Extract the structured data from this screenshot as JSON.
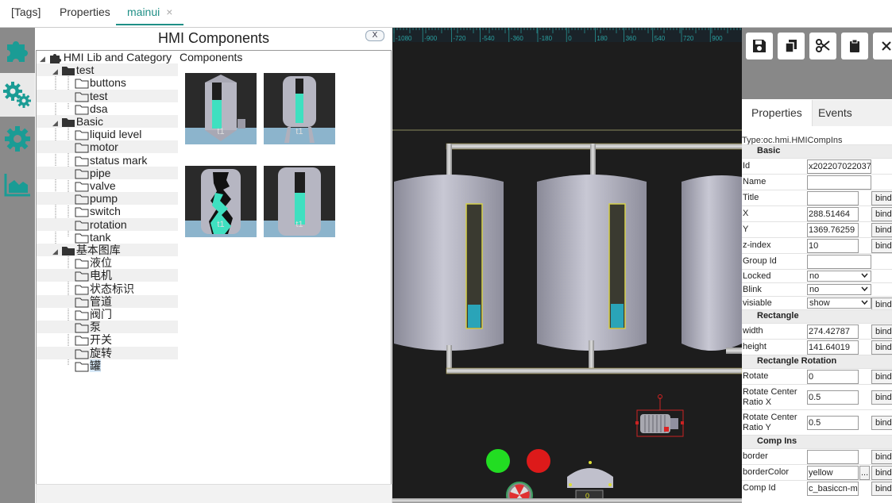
{
  "tabs": [
    "[Tags]",
    "Properties",
    "mainui"
  ],
  "tab_close": "×",
  "left_icons": [
    "puzzle-icon",
    "gears-icon",
    "gear-icon",
    "area-chart-icon"
  ],
  "hmi": {
    "title": "HMI Components",
    "close_label": "X",
    "components_header": "Components",
    "tree": {
      "root": "HMI Lib and Category",
      "groups": [
        {
          "name": "test",
          "items": [
            "buttons",
            "test",
            "dsa"
          ]
        },
        {
          "name": "Basic",
          "items": [
            "liquid level",
            "motor",
            "status mark",
            "pipe",
            "valve",
            "pump",
            "switch",
            "rotation",
            "tank"
          ]
        },
        {
          "name": "基本图库",
          "items": [
            "液位",
            "电机",
            "状态标识",
            "管道",
            "阀门",
            "泵",
            "开关",
            "旋转",
            "罐"
          ]
        }
      ],
      "selected": "罐"
    },
    "components": [
      {
        "label": "t1"
      },
      {
        "label": "t1"
      },
      {
        "label": "t1"
      },
      {
        "label": "t1"
      }
    ]
  },
  "canvas": {
    "ruler_labels": [
      "-1080",
      "-900",
      "-720",
      "-540",
      "-360",
      "-180",
      "0",
      "180",
      "360",
      "540",
      "720",
      "900"
    ],
    "level_indicator": "0"
  },
  "props": {
    "tabs": [
      "Properties",
      "Events"
    ],
    "type_label": "Type:oc.hmi.HMICompIns",
    "bind_label": "bind",
    "more_label": "...",
    "sections": [
      {
        "title": "Basic",
        "rows": [
          {
            "label": "Id",
            "value": "x202207022037",
            "kind": "input",
            "bind": false
          },
          {
            "label": "Name",
            "value": "",
            "kind": "input",
            "bind": false
          },
          {
            "label": "Title",
            "value": "",
            "kind": "input",
            "bind": true
          },
          {
            "label": "X",
            "value": "288.51464",
            "kind": "input",
            "bind": true
          },
          {
            "label": "Y",
            "value": "1369.76259",
            "kind": "input",
            "bind": true
          },
          {
            "label": "z-index",
            "value": "10",
            "kind": "input",
            "bind": true
          },
          {
            "label": "Group Id",
            "value": "",
            "kind": "input",
            "bind": false
          },
          {
            "label": "Locked",
            "value": "no",
            "kind": "select",
            "bind": false
          },
          {
            "label": "Blink",
            "value": "no",
            "kind": "select",
            "bind": false
          },
          {
            "label": "visiable",
            "value": "show",
            "kind": "select",
            "bind": true
          }
        ]
      },
      {
        "title": "Rectangle",
        "rows": [
          {
            "label": "width",
            "value": "274.42787",
            "kind": "input",
            "bind": true
          },
          {
            "label": "height",
            "value": "141.64019",
            "kind": "input",
            "bind": true
          }
        ]
      },
      {
        "title": "Rectangle Rotation",
        "rows": [
          {
            "label": "Rotate",
            "value": "0",
            "kind": "input",
            "bind": true
          },
          {
            "label": "Rotate Center Ratio X",
            "value": "0.5",
            "kind": "input",
            "bind": true
          },
          {
            "label": "Rotate Center Ratio Y",
            "value": "0.5",
            "kind": "input",
            "bind": true
          }
        ]
      },
      {
        "title": "Comp Ins",
        "rows": [
          {
            "label": "border",
            "value": "",
            "kind": "input",
            "bind": true
          },
          {
            "label": "borderColor",
            "value": "yellow",
            "kind": "input",
            "bind": true,
            "more": true
          },
          {
            "label": "Comp Id",
            "value": "c_basiccn-mhM",
            "kind": "input",
            "bind": true
          }
        ]
      }
    ]
  },
  "colors": {
    "accent": "#1f8f86",
    "icon_teal": "#1a9c95",
    "liquid": "#3fe0c0",
    "canvas_bg": "#1d1d1d",
    "status_green": "#22dd22",
    "status_red": "#dd1a1a"
  }
}
